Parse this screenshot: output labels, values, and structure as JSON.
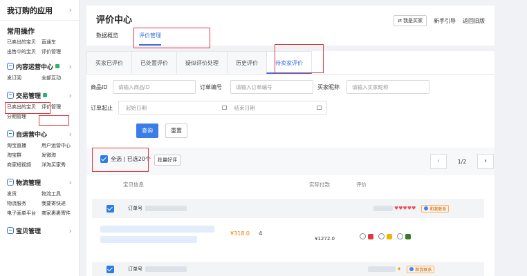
{
  "sidebar": {
    "top_title": "我订购的应用",
    "sections": [
      {
        "title": "常用操作",
        "links": [
          "已卖出的宝贝",
          "直通车",
          "出售中的宝贝",
          "评价管理"
        ]
      },
      {
        "title": "内容运营中心",
        "links": [
          "发订阅",
          "全部互动"
        ]
      },
      {
        "title": "交易管理",
        "links": [
          "已卖出的宝贝",
          "评价管理",
          "分期管理"
        ]
      },
      {
        "title": "自运营中心",
        "links": [
          "淘宝直播",
          "用户运营中心",
          "淘宝群",
          "发微淘",
          "商家短视频",
          "洋淘买家秀"
        ]
      },
      {
        "title": "物流管理",
        "links": [
          "发货",
          "物流工具",
          "物流服务",
          "我要寄快递",
          "电子面单平台",
          "商家裹裹寄件"
        ]
      },
      {
        "title": "宝贝管理",
        "links": []
      }
    ]
  },
  "header": {
    "title": "评价中心",
    "tabs": [
      "数据概览",
      "评价管理"
    ],
    "links": [
      "我是买家",
      "新手引导",
      "返回旧版"
    ]
  },
  "subtabs": [
    "买家已评价",
    "已处置评价",
    "疑似评价处理",
    "历史评价",
    "待卖家评价"
  ],
  "filters": {
    "item_id_label": "商品ID",
    "item_id_ph": "请输入商品ID",
    "order_label": "订单编号",
    "order_ph": "请输入订单编号",
    "buyer_label": "买家昵称",
    "buyer_ph": "请输入买家昵称",
    "date_label": "订单起止",
    "start_ph": "起始日期",
    "end_ph": "结束日期",
    "query": "查询",
    "reset": "重置"
  },
  "bulk": {
    "select_all": "全选 | 已选20个",
    "batch": "批量好评"
  },
  "pager": {
    "page": "1/2",
    "prev": "‹",
    "next": "›"
  },
  "table": {
    "headers": [
      "宝贝信息",
      "实际付款",
      "评价"
    ],
    "order_label": "订单号",
    "contact": "和我联系",
    "row1": {
      "price": "¥318.0",
      "qty": "4",
      "paid": "¥1272.0"
    }
  },
  "colors": {
    "accent": "#3a7de8",
    "highlight": "#e0383e"
  }
}
